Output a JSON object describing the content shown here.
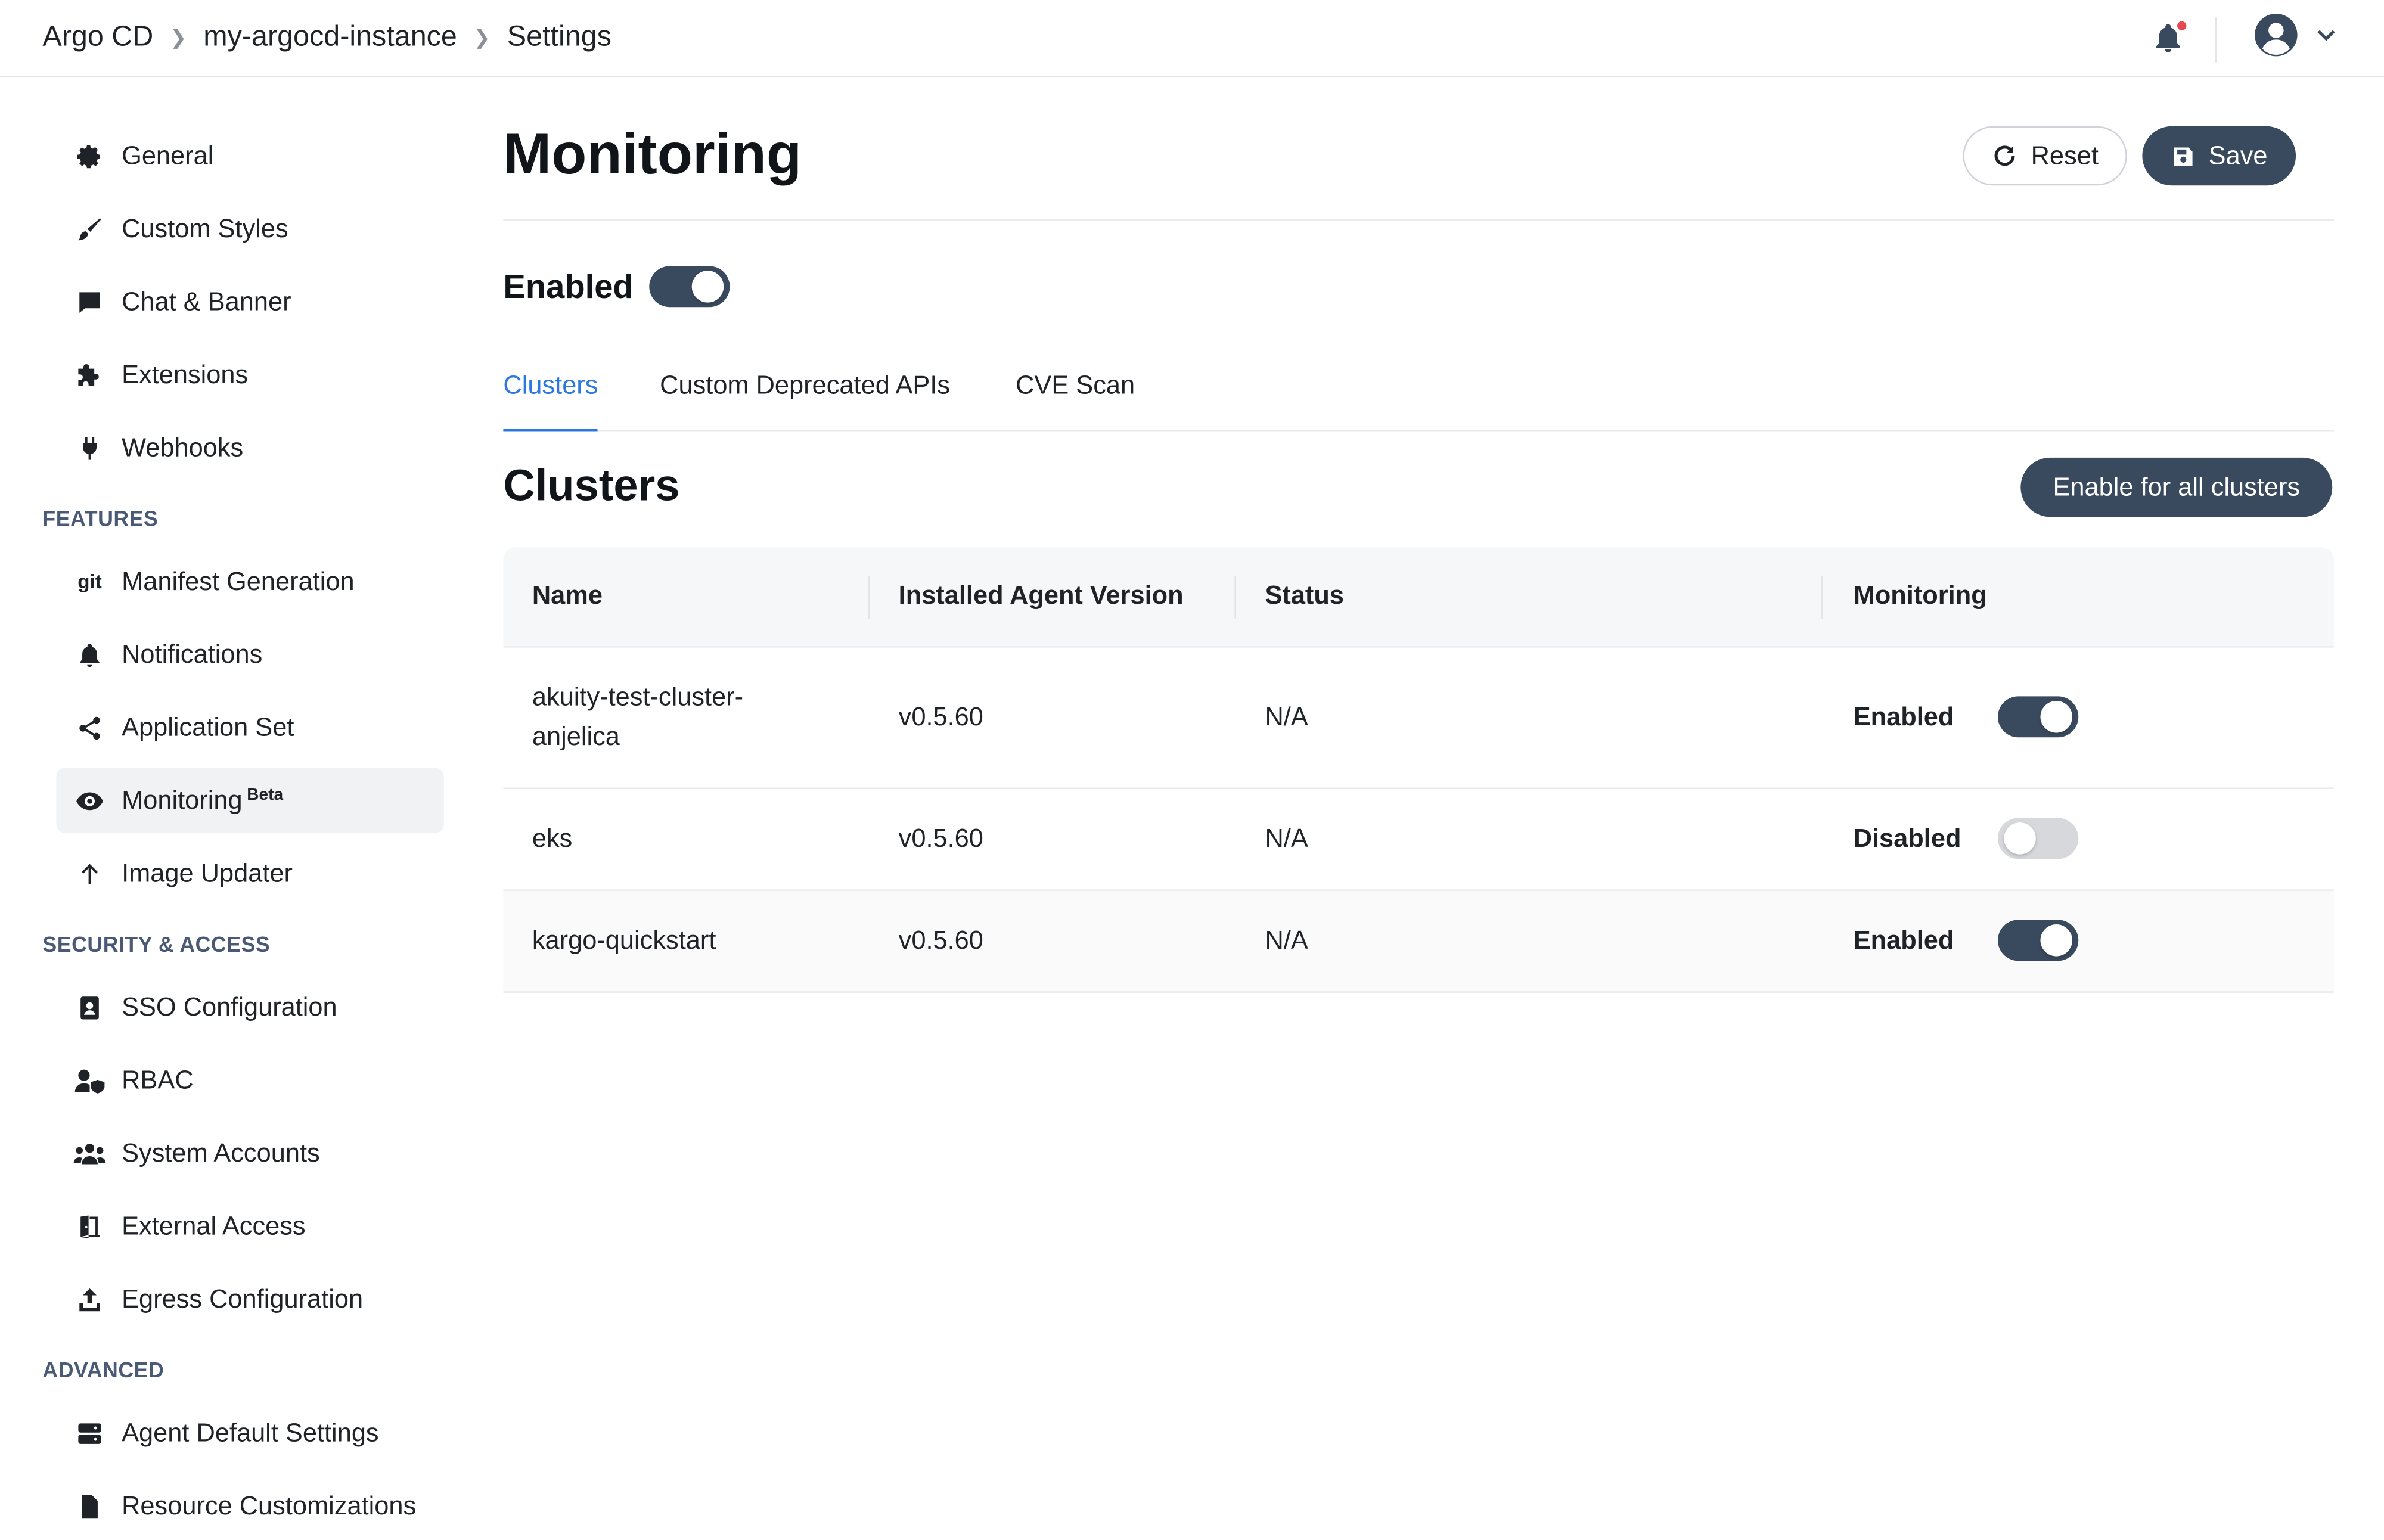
{
  "breadcrumb": [
    "Argo CD",
    "my-argocd-instance",
    "Settings"
  ],
  "header": {
    "notification_icon": "bell-icon",
    "user_icon": "user-circle-icon"
  },
  "sidebar": {
    "items_top": [
      {
        "label": "General",
        "icon": "gear-icon"
      },
      {
        "label": "Custom Styles",
        "icon": "brush-icon"
      },
      {
        "label": "Chat & Banner",
        "icon": "chat-icon"
      },
      {
        "label": "Extensions",
        "icon": "puzzle-icon"
      },
      {
        "label": "Webhooks",
        "icon": "plug-icon"
      }
    ],
    "features_heading": "FEATURES",
    "features": [
      {
        "label": "Manifest Generation",
        "icon": "git-icon"
      },
      {
        "label": "Notifications",
        "icon": "bell-icon"
      },
      {
        "label": "Application Set",
        "icon": "share-icon"
      },
      {
        "label": "Monitoring",
        "badge": "Beta",
        "icon": "eye-icon",
        "active": true
      },
      {
        "label": "Image Updater",
        "icon": "arrow-up-icon"
      }
    ],
    "security_heading": "SECURITY & ACCESS",
    "security": [
      {
        "label": "SSO Configuration",
        "icon": "id-badge-icon"
      },
      {
        "label": "RBAC",
        "icon": "user-shield-icon"
      },
      {
        "label": "System Accounts",
        "icon": "users-icon"
      },
      {
        "label": "External Access",
        "icon": "door-icon"
      },
      {
        "label": "Egress Configuration",
        "icon": "upload-icon"
      }
    ],
    "advanced_heading": "ADVANCED",
    "advanced": [
      {
        "label": "Agent Default Settings",
        "icon": "server-icon"
      },
      {
        "label": "Resource Customizations",
        "icon": "file-code-icon"
      }
    ]
  },
  "main": {
    "title": "Monitoring",
    "reset_label": "Reset",
    "save_label": "Save",
    "enabled_label": "Enabled",
    "enabled": true,
    "tabs": [
      {
        "label": "Clusters",
        "active": true
      },
      {
        "label": "Custom Deprecated APIs",
        "active": false
      },
      {
        "label": "CVE Scan",
        "active": false
      }
    ],
    "section_title": "Clusters",
    "enable_all_label": "Enable for all clusters",
    "table": {
      "columns": [
        "Name",
        "Installed Agent Version",
        "Status",
        "Monitoring"
      ],
      "rows": [
        {
          "name_line1": "akuity-test-cluster-",
          "name_line2": "anjelica",
          "version": "v0.5.60",
          "status": "N/A",
          "monitoring": "Enabled",
          "on": true
        },
        {
          "name_line1": "eks",
          "name_line2": "",
          "version": "v0.5.60",
          "status": "N/A",
          "monitoring": "Disabled",
          "on": false
        },
        {
          "name_line1": "kargo-quickstart",
          "name_line2": "",
          "version": "v0.5.60",
          "status": "N/A",
          "monitoring": "Enabled",
          "on": true
        }
      ]
    }
  },
  "colors": {
    "accent": "#2c77e0",
    "primary_button": "#3a4a5e",
    "toggle_off": "#d6d8dc",
    "notification_dot": "#e5484d"
  }
}
